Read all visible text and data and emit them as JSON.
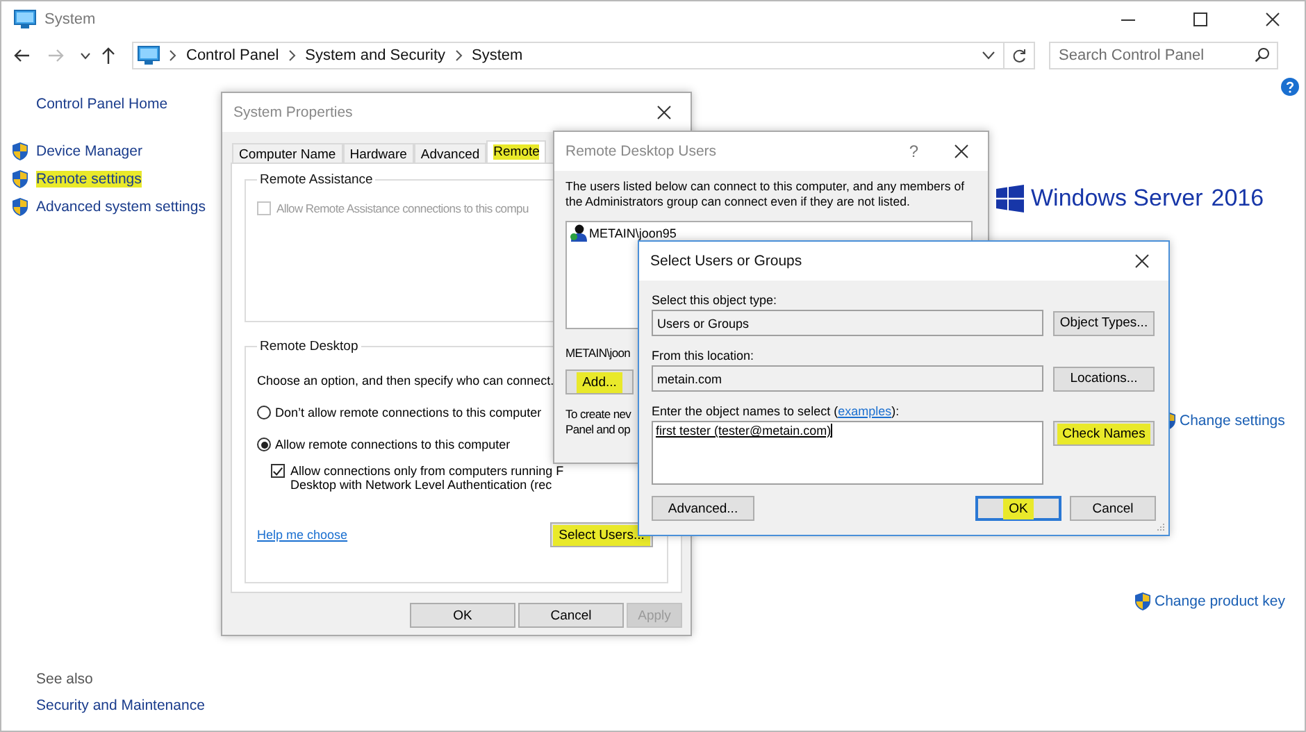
{
  "window": {
    "title": "System"
  },
  "address_bar": {
    "path": [
      "Control Panel",
      "System and Security",
      "System"
    ]
  },
  "search": {
    "placeholder": "Search Control Panel"
  },
  "sidebar": {
    "home": "Control Panel Home",
    "items": [
      {
        "label": "Device Manager",
        "highlighted": false
      },
      {
        "label": "Remote settings",
        "highlighted": true
      },
      {
        "label": "Advanced system settings",
        "highlighted": false
      }
    ],
    "see_also": "See also",
    "see_also_items": [
      "Security and Maintenance"
    ]
  },
  "main": {
    "edition": "Windows Server",
    "edition_year": "2016",
    "links": [
      "Change settings",
      "Change product key"
    ]
  },
  "system_properties": {
    "title": "System Properties",
    "tabs": [
      {
        "label": "Computer Name",
        "selected": false,
        "highlighted": false
      },
      {
        "label": "Hardware",
        "selected": false,
        "highlighted": false
      },
      {
        "label": "Advanced",
        "selected": false,
        "highlighted": false
      },
      {
        "label": "Remote",
        "selected": true,
        "highlighted": true
      }
    ],
    "remote_assistance": {
      "title": "Remote Assistance",
      "checkbox": {
        "label": "Allow Remote Assistance connections to this compu",
        "checked": false,
        "disabled": true
      }
    },
    "remote_desktop": {
      "title": "Remote Desktop",
      "intro": "Choose an option, and then specify who can connect.",
      "options": [
        {
          "label": "Don’t allow remote connections to this computer",
          "selected": false
        },
        {
          "label": "Allow remote connections to this computer",
          "selected": true
        }
      ],
      "nla": {
        "lines": [
          "Allow connections only from computers running F",
          "Desktop with Network Level Authentication (rec"
        ],
        "checked": true
      },
      "help_link": "Help me choose",
      "select_users": {
        "label": "Select Users...",
        "highlighted": true
      }
    },
    "buttons": [
      {
        "label": "OK",
        "disabled": false
      },
      {
        "label": "Cancel",
        "disabled": false
      },
      {
        "label": "Apply",
        "disabled": true
      }
    ]
  },
  "remote_desktop_users": {
    "title": "Remote Desktop Users",
    "help": "?",
    "description": "The users listed below can connect to this computer, and any members of the Administrators group can connect even if they are not listed.",
    "users": [
      {
        "name": "METAIN\\joon95"
      }
    ],
    "member_note": "METAIN\\joon",
    "add_button": {
      "label": "Add...",
      "highlighted": true
    },
    "note_lines": [
      "To create nev",
      "Panel and op"
    ]
  },
  "select_users": {
    "title": "Select Users or Groups",
    "object_type_label": "Select this object type:",
    "object_type": "Users or Groups",
    "object_types_button": {
      "label": "Object Types...",
      "highlighted": false
    },
    "location_label": "From this location:",
    "location": "metain.com",
    "locations_button": {
      "label": "Locations...",
      "highlighted": false
    },
    "names_label": "Enter the object names to select (",
    "examples_link": "examples",
    "names_label_end": "):",
    "names_value": "first tester (tester@metain.com)",
    "check_names_button": {
      "label": "Check Names",
      "highlighted": true
    },
    "buttons": [
      {
        "label": "Advanced...",
        "highlighted": false,
        "default": false
      },
      {
        "label": "OK",
        "highlighted": true,
        "default": true
      },
      {
        "label": "Cancel",
        "highlighted": false,
        "default": false
      }
    ]
  }
}
